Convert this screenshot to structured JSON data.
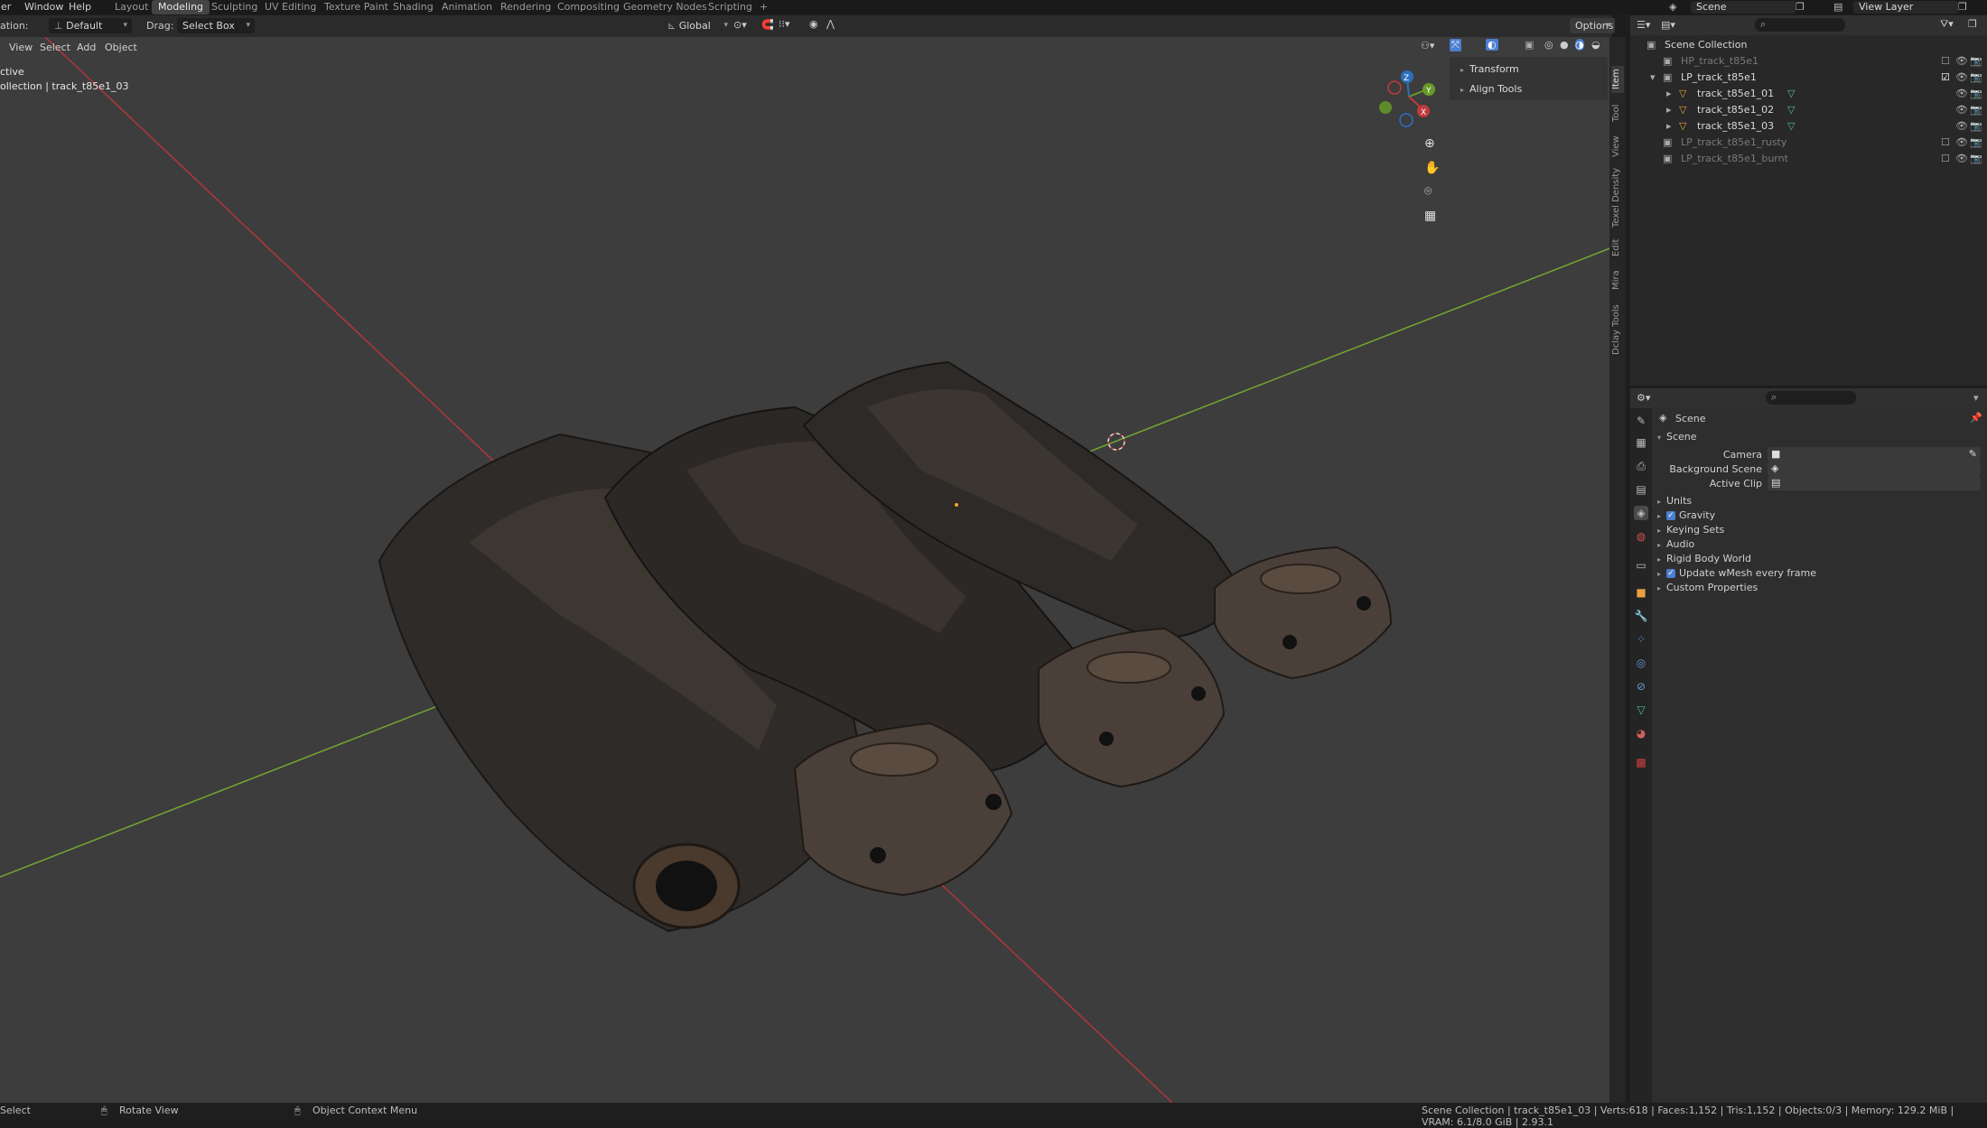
{
  "topbar": {
    "menus": [
      "der",
      "Window",
      "Help"
    ],
    "workspaces": [
      "Layout",
      "Modeling",
      "Sculpting",
      "UV Editing",
      "Texture Paint",
      "Shading",
      "Animation",
      "Rendering",
      "Compositing",
      "Geometry Nodes",
      "Scripting",
      "+"
    ],
    "active_workspace": "Modeling",
    "scene": "Scene",
    "view_layer": "View Layer"
  },
  "header": {
    "orientation_label": "ation:",
    "orientation_value": "Default",
    "drag_label": "Drag:",
    "drag_value": "Select Box",
    "transform_orientation": "Global",
    "options_label": "Options"
  },
  "viewport": {
    "menu": [
      "View",
      "Select",
      "Add",
      "Object"
    ],
    "mode_text": "ctive",
    "collection_text": "ollection | track_t85e1_03",
    "npanel_items": [
      "Transform",
      "Align Tools"
    ],
    "side_tabs": [
      "Item",
      "Tool",
      "View",
      "Texel Density",
      "Edit",
      "Mira",
      "Dclay Tools"
    ],
    "active_tab": "Item",
    "gizmo_axes": [
      "Z",
      "Y",
      "X"
    ]
  },
  "outliner": {
    "search_placeholder": "",
    "root": "Scene Collection",
    "rows": [
      {
        "name": "HP_track_t85e1",
        "indent": 1,
        "dim": true
      },
      {
        "name": "LP_track_t85e1",
        "indent": 1,
        "dim": false
      },
      {
        "name": "track_t85e1_01",
        "indent": 2,
        "dim": false
      },
      {
        "name": "track_t85e1_02",
        "indent": 2,
        "dim": false
      },
      {
        "name": "track_t85e1_03",
        "indent": 2,
        "dim": false
      },
      {
        "name": "LP_track_t85e1_rusty",
        "indent": 1,
        "dim": true
      },
      {
        "name": "LP_track_t85e1_burnt",
        "indent": 1,
        "dim": true
      }
    ]
  },
  "properties": {
    "breadcrumb": "Scene",
    "section": "Scene",
    "fields": [
      {
        "label": "Camera",
        "value": ""
      },
      {
        "label": "Background Scene",
        "value": ""
      },
      {
        "label": "Active Clip",
        "value": ""
      }
    ],
    "panels": [
      {
        "label": "Units",
        "checkbox": false
      },
      {
        "label": "Gravity",
        "checkbox": true
      },
      {
        "label": "Keying Sets",
        "checkbox": false
      },
      {
        "label": "Audio",
        "checkbox": false
      },
      {
        "label": "Rigid Body World",
        "checkbox": false
      },
      {
        "label": "Update wMesh every frame",
        "checkbox": true
      },
      {
        "label": "Custom Properties",
        "checkbox": false
      }
    ]
  },
  "statusbar": {
    "select": "Select",
    "rotate": "Rotate View",
    "context": "Object Context Menu",
    "stats": "Scene Collection | track_t85e1_03 | Verts:618 | Faces:1,152 | Tris:1,152 | Objects:0/3 | Memory: 129.2 MiB | VRAM: 6.1/8.0 GiB | 2.93.1"
  },
  "colors": {
    "x_axis": "#b3353d",
    "y_axis": "#76a632",
    "accent": "#4b7fcf"
  }
}
